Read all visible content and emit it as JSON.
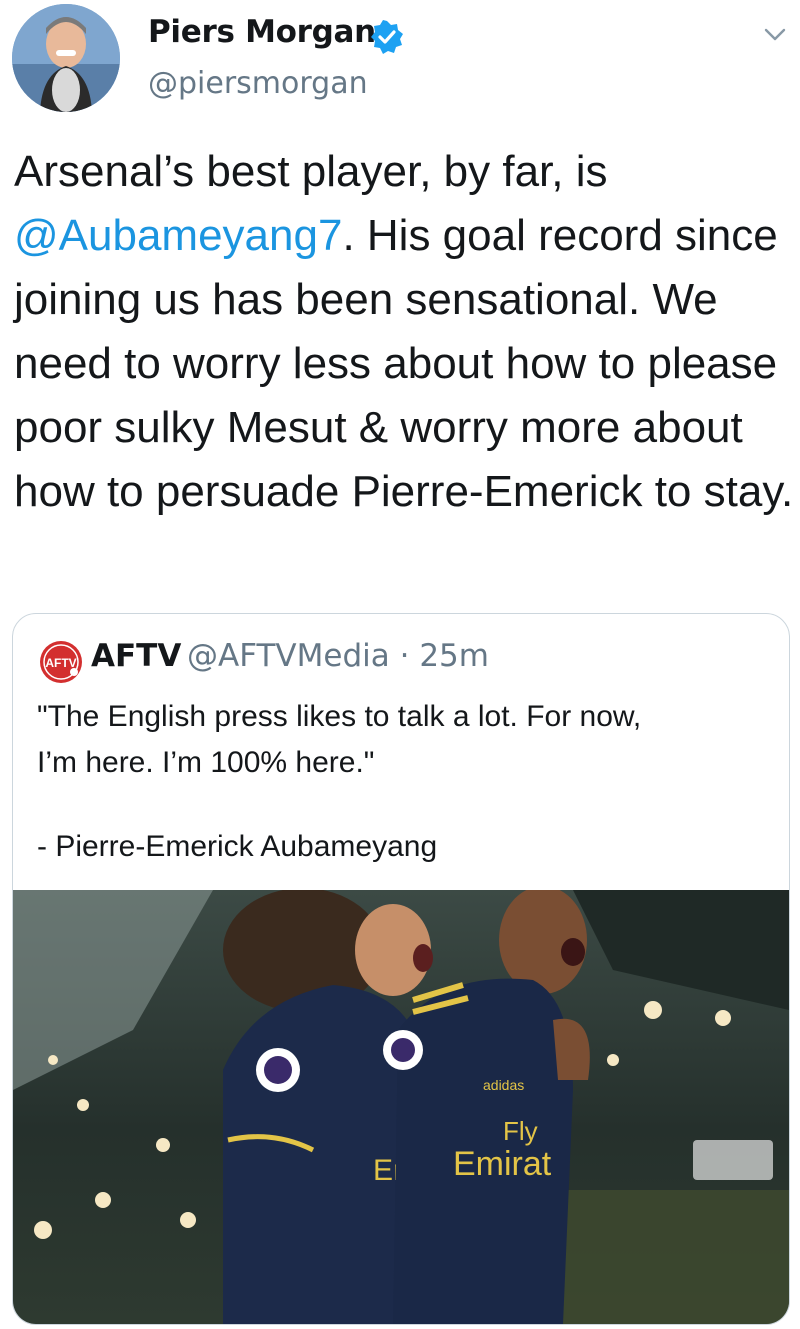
{
  "author": {
    "name": "Piers Morgan",
    "handle": "@piersmorgan",
    "verified_icon": "verified-badge-icon",
    "menu_icon": "chevron-down-icon"
  },
  "tweet": {
    "text_before": "Arsenal’s best player, by far, is ",
    "mention": "@Aubameyang7",
    "text_after": ". His goal record since joining us has been sensational. We need to worry less about how to please poor sulky Mesut & worry more about how to persuade Pierre-Emerick to stay."
  },
  "quoted": {
    "logo_text": "AFTV",
    "name": "AFTV",
    "handle": "@AFTVMedia",
    "separator": " · ",
    "time": "25m",
    "quote_line1": "\"The English press likes to talk a lot. For now,",
    "quote_line2": "I’m here. I’m 100% here.\"",
    "attribution": "- Pierre-Emerick Aubameyang",
    "photo": {
      "sponsor_text_left": "Em",
      "sponsor_text_right_top": "Fly",
      "sponsor_text_right": "Emirat",
      "kit_brand": "adidas"
    }
  },
  "colors": {
    "link": "#1b95e0",
    "secondary_text": "#657786",
    "border": "#ccd6dd",
    "verified": "#1da1f2",
    "aftv_red": "#d32f2f"
  }
}
